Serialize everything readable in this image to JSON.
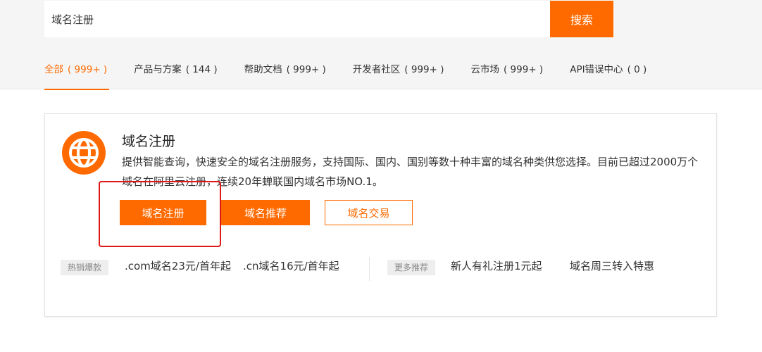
{
  "search": {
    "value": "域名注册",
    "button_label": "搜索"
  },
  "tabs": [
    {
      "label": "全部",
      "count": "( 999+ )",
      "active": true
    },
    {
      "label": "产品与方案",
      "count": "( 144 )"
    },
    {
      "label": "帮助文档",
      "count": "( 999+ )"
    },
    {
      "label": "开发者社区",
      "count": "( 999+ )"
    },
    {
      "label": "云市场",
      "count": "( 999+ )"
    },
    {
      "label": "API错误中心",
      "count": "( 0 )"
    }
  ],
  "card": {
    "icon": "globe-icon",
    "title": "域名注册",
    "description": "提供智能查询，快速安全的域名注册服务，支持国际、国内、国别等数十种丰富的域名种类供您选择。目前已超过2000万个域名在阿里云注册，连续20年蝉联国内域名市场NO.1。",
    "buttons": {
      "register": "域名注册",
      "recommend": "域名推荐",
      "trade": "域名交易"
    },
    "hot": {
      "tag": "热销爆款",
      "links": [
        ".com域名23元/首年起",
        ".cn域名16元/首年起"
      ]
    },
    "more": {
      "tag": "更多推荐",
      "links": [
        "新人有礼注册1元起",
        "域名周三转入特惠"
      ]
    }
  },
  "colors": {
    "accent": "#ff6a00",
    "highlight": "#e01818"
  }
}
